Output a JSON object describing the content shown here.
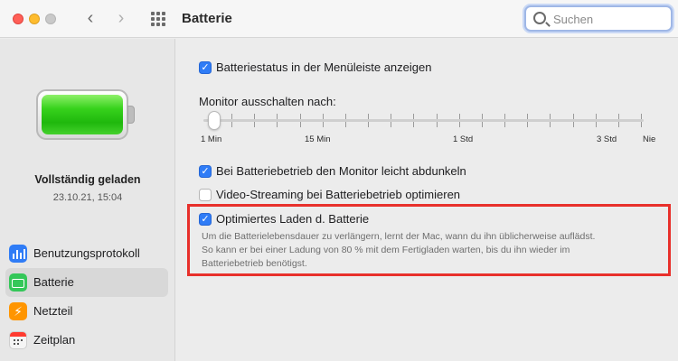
{
  "toolbar": {
    "title": "Batterie",
    "search_placeholder": "Suchen",
    "back_icon": "chevron-left-icon",
    "forward_icon": "chevron-right-icon",
    "grid_icon": "grid-icon"
  },
  "sidebar": {
    "status_title": "Vollständig geladen",
    "status_date": "23.10.21, 15:04",
    "items": [
      {
        "label": "Benutzungsprotokoll",
        "icon": "chart-icon",
        "selected": false
      },
      {
        "label": "Batterie",
        "icon": "battery-icon",
        "selected": true
      },
      {
        "label": "Netzteil",
        "icon": "power-icon",
        "selected": false
      },
      {
        "label": "Zeitplan",
        "icon": "calendar-icon",
        "selected": false
      }
    ]
  },
  "main": {
    "show_status": {
      "label": "Batteriestatus in der Menüleiste anzeigen",
      "checked": true
    },
    "monitor_off": {
      "label": "Monitor ausschalten nach:",
      "tick_labels": [
        "1 Min",
        "15 Min",
        "1 Std",
        "3 Std",
        "Nie"
      ],
      "value": "1 Min"
    },
    "dim_display": {
      "label": "Bei Batteriebetrieb den Monitor leicht abdunkeln",
      "checked": true
    },
    "video_streaming": {
      "label": "Video-Streaming bei Batteriebetrieb optimieren",
      "checked": false
    },
    "optimized_charging": {
      "label": "Optimiertes Laden d. Batterie",
      "checked": true,
      "description_lines": [
        "Um die Batterielebensdauer zu verlängern, lernt der Mac, wann du ihn üblicherweise auflädst.",
        "So kann er bei einer Ladung von 80 % mit dem Fertigladen warten, bis du ihn wieder im",
        "Batteriebetrieb benötigst."
      ]
    }
  },
  "colors": {
    "accent": "#2f7cf6",
    "highlight": "#e8302b",
    "battery_fill": "#34c759"
  }
}
